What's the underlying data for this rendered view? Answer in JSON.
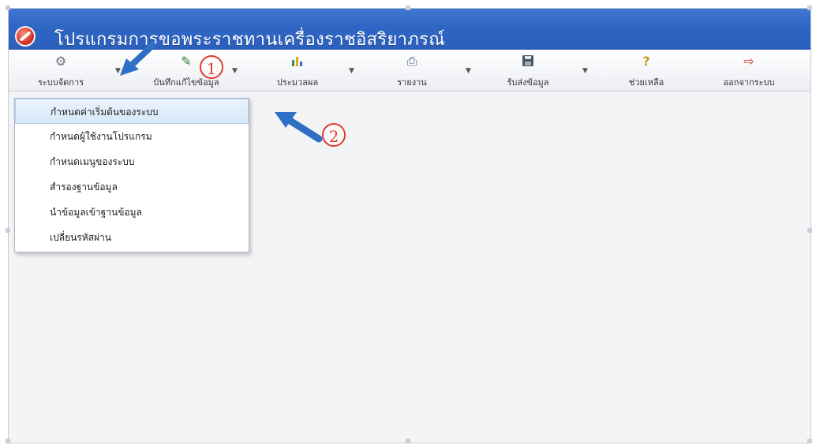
{
  "window": {
    "title": "โปรแกรมการขอพระราชทานเครื่องราชอิสริยาภรณ์"
  },
  "toolbar": {
    "items": [
      {
        "label": "ระบบจัดการ",
        "icon": "gear-tools-icon"
      },
      {
        "label": "บันทึกแก้ไขข้อมูล",
        "icon": "edit-book-icon"
      },
      {
        "label": "ประมวลผล",
        "icon": "bar-chart-icon"
      },
      {
        "label": "รายงาน",
        "icon": "printer-icon"
      },
      {
        "label": "รับส่งข้อมูล",
        "icon": "floppy-disk-icon"
      },
      {
        "label": "ช่วยเหลือ",
        "icon": "help-icon"
      },
      {
        "label": "ออกจากระบบ",
        "icon": "exit-icon"
      }
    ]
  },
  "menu": {
    "items": [
      {
        "label": "กำหนดค่าเริ่มต้นของระบบ",
        "highlighted": true
      },
      {
        "label": "กำหนดผู้ใช้งานโปรแกรม"
      },
      {
        "label": "กำหนดเมนูของระบบ"
      },
      {
        "label": "สำรองฐานข้อมูล"
      },
      {
        "label": "นำข้อมูลเข้าฐานข้อมูล"
      },
      {
        "label": "เปลี่ยนรหัสผ่าน"
      }
    ]
  },
  "annotations": {
    "callout_1": "1",
    "callout_2": "2",
    "arrow_color": "#2f6fc4",
    "callout_color": "#e23b2d"
  },
  "colors": {
    "titlebar": "#2f66c4",
    "menu_highlight": "#d7e8f8"
  }
}
